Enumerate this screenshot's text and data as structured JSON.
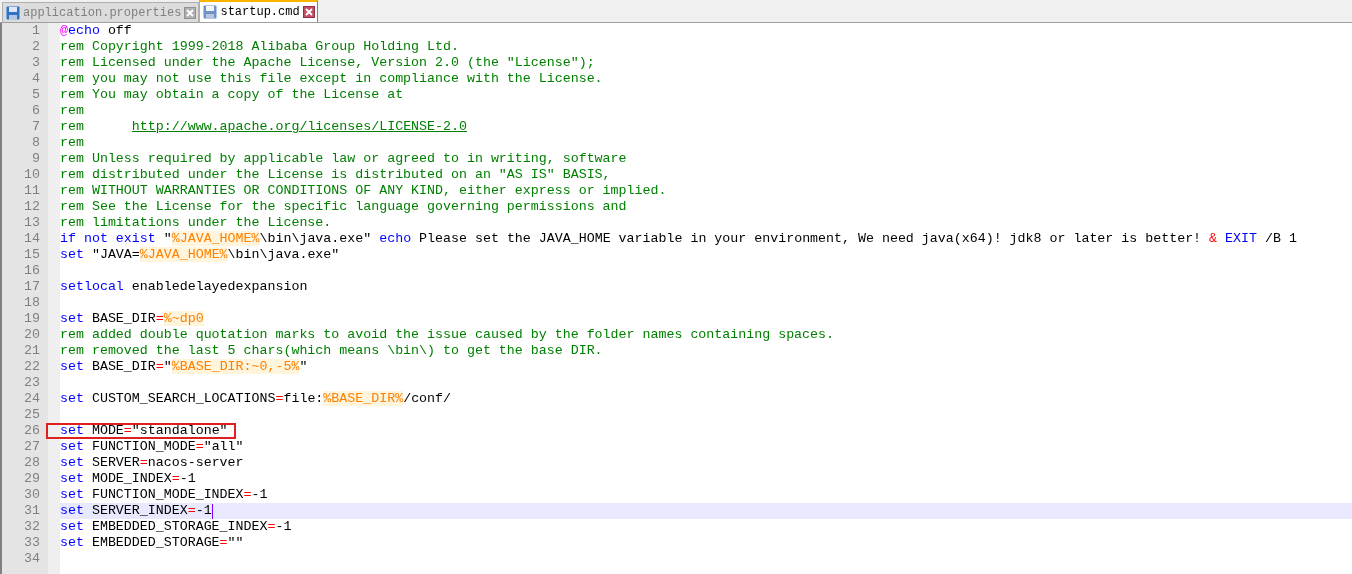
{
  "tabs": [
    {
      "label": "application.properties",
      "selected": false
    },
    {
      "label": "startup.cmd",
      "selected": true
    }
  ],
  "editor": {
    "lines": [
      {
        "number": "1",
        "current": false,
        "boxed": false,
        "tokens": [
          {
            "kind": "at",
            "text": "@"
          },
          {
            "kind": "keyword",
            "text": "echo"
          },
          {
            "kind": "plain",
            "text": " off"
          }
        ]
      },
      {
        "number": "2",
        "current": false,
        "boxed": false,
        "tokens": [
          {
            "kind": "comment",
            "text": "rem Copyright 1999-2018 Alibaba Group Holding Ltd."
          }
        ]
      },
      {
        "number": "3",
        "current": false,
        "boxed": false,
        "tokens": [
          {
            "kind": "comment",
            "text": "rem Licensed under the Apache License, Version 2.0 (the \"License\");"
          }
        ]
      },
      {
        "number": "4",
        "current": false,
        "boxed": false,
        "tokens": [
          {
            "kind": "comment",
            "text": "rem you may not use this file except in compliance with the License."
          }
        ]
      },
      {
        "number": "5",
        "current": false,
        "boxed": false,
        "tokens": [
          {
            "kind": "comment",
            "text": "rem You may obtain a copy of the License at"
          }
        ]
      },
      {
        "number": "6",
        "current": false,
        "boxed": false,
        "tokens": [
          {
            "kind": "comment",
            "text": "rem"
          }
        ]
      },
      {
        "number": "7",
        "current": false,
        "boxed": false,
        "tokens": [
          {
            "kind": "comment",
            "text": "rem      "
          },
          {
            "kind": "link",
            "text": "http://www.apache.org/licenses/LICENSE-2.0"
          }
        ]
      },
      {
        "number": "8",
        "current": false,
        "boxed": false,
        "tokens": [
          {
            "kind": "comment",
            "text": "rem"
          }
        ]
      },
      {
        "number": "9",
        "current": false,
        "boxed": false,
        "tokens": [
          {
            "kind": "comment",
            "text": "rem Unless required by applicable law or agreed to in writing, software"
          }
        ]
      },
      {
        "number": "10",
        "current": false,
        "boxed": false,
        "tokens": [
          {
            "kind": "comment",
            "text": "rem distributed under the License is distributed on an \"AS IS\" BASIS,"
          }
        ]
      },
      {
        "number": "11",
        "current": false,
        "boxed": false,
        "tokens": [
          {
            "kind": "comment",
            "text": "rem WITHOUT WARRANTIES OR CONDITIONS OF ANY KIND, either express or implied."
          }
        ]
      },
      {
        "number": "12",
        "current": false,
        "boxed": false,
        "tokens": [
          {
            "kind": "comment",
            "text": "rem See the License for the specific language governing permissions and"
          }
        ]
      },
      {
        "number": "13",
        "current": false,
        "boxed": false,
        "tokens": [
          {
            "kind": "comment",
            "text": "rem limitations under the License."
          }
        ]
      },
      {
        "number": "14",
        "current": false,
        "boxed": false,
        "tokens": [
          {
            "kind": "keyword",
            "text": "if not exist"
          },
          {
            "kind": "plain",
            "text": " \""
          },
          {
            "kind": "variable",
            "text": "%JAVA_HOME%"
          },
          {
            "kind": "plain",
            "text": "\\bin\\java.exe\" "
          },
          {
            "kind": "keyword",
            "text": "echo"
          },
          {
            "kind": "plain",
            "text": " Please set the JAVA_HOME variable in your environment, We need java(x64)! jdk8 or later is better! "
          },
          {
            "kind": "operator",
            "text": "&"
          },
          {
            "kind": "keyword",
            "text": " EXIT"
          },
          {
            "kind": "plain",
            "text": " /B 1"
          }
        ]
      },
      {
        "number": "15",
        "current": false,
        "boxed": false,
        "tokens": [
          {
            "kind": "keyword",
            "text": "set"
          },
          {
            "kind": "plain",
            "text": " \"JAVA="
          },
          {
            "kind": "variable",
            "text": "%JAVA_HOME%"
          },
          {
            "kind": "plain",
            "text": "\\bin\\java.exe\""
          }
        ]
      },
      {
        "number": "16",
        "current": false
      },
      {
        "number": "17",
        "current": false,
        "boxed": false,
        "tokens": [
          {
            "kind": "keyword",
            "text": "setlocal"
          },
          {
            "kind": "plain",
            "text": " enabledelayedexpansion"
          }
        ]
      },
      {
        "number": "18",
        "current": false
      },
      {
        "number": "19",
        "current": false,
        "boxed": false,
        "tokens": [
          {
            "kind": "keyword",
            "text": "set"
          },
          {
            "kind": "plain",
            "text": " BASE_DIR"
          },
          {
            "kind": "operator",
            "text": "="
          },
          {
            "kind": "variable",
            "text": "%~dp0"
          }
        ]
      },
      {
        "number": "20",
        "current": false,
        "boxed": false,
        "tokens": [
          {
            "kind": "comment",
            "text": "rem added double quotation marks to avoid the issue caused by the folder names containing spaces."
          }
        ]
      },
      {
        "number": "21",
        "current": false,
        "boxed": false,
        "tokens": [
          {
            "kind": "comment",
            "text": "rem removed the last 5 chars(which means \\bin\\) to get the base DIR."
          }
        ]
      },
      {
        "number": "22",
        "current": false,
        "boxed": false,
        "tokens": [
          {
            "kind": "keyword",
            "text": "set"
          },
          {
            "kind": "plain",
            "text": " BASE_DIR"
          },
          {
            "kind": "operator",
            "text": "="
          },
          {
            "kind": "plain",
            "text": "\""
          },
          {
            "kind": "variable",
            "text": "%BASE_DIR:~0,-5%"
          },
          {
            "kind": "plain",
            "text": "\""
          }
        ]
      },
      {
        "number": "23",
        "current": false
      },
      {
        "number": "24",
        "current": false,
        "boxed": false,
        "tokens": [
          {
            "kind": "keyword",
            "text": "set"
          },
          {
            "kind": "plain",
            "text": " CUSTOM_SEARCH_LOCATIONS"
          },
          {
            "kind": "operator",
            "text": "="
          },
          {
            "kind": "plain",
            "text": "file:"
          },
          {
            "kind": "variable",
            "text": "%BASE_DIR%"
          },
          {
            "kind": "plain",
            "text": "/conf/"
          }
        ]
      },
      {
        "number": "25",
        "current": false
      },
      {
        "number": "26",
        "current": false,
        "boxed": true,
        "tokens": [
          {
            "kind": "keyword",
            "text": "set"
          },
          {
            "kind": "plain",
            "text": " MODE"
          },
          {
            "kind": "operator",
            "text": "="
          },
          {
            "kind": "plain",
            "text": "\"standalone\""
          }
        ]
      },
      {
        "number": "27",
        "current": false,
        "boxed": false,
        "tokens": [
          {
            "kind": "keyword",
            "text": "set"
          },
          {
            "kind": "plain",
            "text": " FUNCTION_MODE"
          },
          {
            "kind": "operator",
            "text": "="
          },
          {
            "kind": "plain",
            "text": "\"all\""
          }
        ]
      },
      {
        "number": "28",
        "current": false,
        "boxed": false,
        "tokens": [
          {
            "kind": "keyword",
            "text": "set"
          },
          {
            "kind": "plain",
            "text": " SERVER"
          },
          {
            "kind": "operator",
            "text": "="
          },
          {
            "kind": "plain",
            "text": "nacos-server"
          }
        ]
      },
      {
        "number": "29",
        "current": false,
        "boxed": false,
        "tokens": [
          {
            "kind": "keyword",
            "text": "set"
          },
          {
            "kind": "plain",
            "text": " MODE_INDEX"
          },
          {
            "kind": "operator",
            "text": "="
          },
          {
            "kind": "plain",
            "text": "-1"
          }
        ]
      },
      {
        "number": "30",
        "current": false,
        "boxed": false,
        "tokens": [
          {
            "kind": "keyword",
            "text": "set"
          },
          {
            "kind": "plain",
            "text": " FUNCTION_MODE_INDEX"
          },
          {
            "kind": "operator",
            "text": "="
          },
          {
            "kind": "plain",
            "text": "-1"
          }
        ]
      },
      {
        "number": "31",
        "current": true,
        "boxed": false,
        "tokens": [
          {
            "kind": "keyword",
            "text": "set"
          },
          {
            "kind": "plain",
            "text": " SERVER_INDEX"
          },
          {
            "kind": "operator",
            "text": "="
          },
          {
            "kind": "plain",
            "text": "-1"
          }
        ]
      },
      {
        "number": "32",
        "current": false,
        "boxed": false,
        "tokens": [
          {
            "kind": "keyword",
            "text": "set"
          },
          {
            "kind": "plain",
            "text": " EMBEDDED_STORAGE_INDEX"
          },
          {
            "kind": "operator",
            "text": "="
          },
          {
            "kind": "plain",
            "text": "-1"
          }
        ]
      },
      {
        "number": "33",
        "current": false,
        "boxed": false,
        "tokens": [
          {
            "kind": "keyword",
            "text": "set"
          },
          {
            "kind": "plain",
            "text": " EMBEDDED_STORAGE"
          },
          {
            "kind": "operator",
            "text": "="
          },
          {
            "kind": "plain",
            "text": "\"\""
          }
        ]
      },
      {
        "number": "34",
        "current": false
      }
    ]
  }
}
